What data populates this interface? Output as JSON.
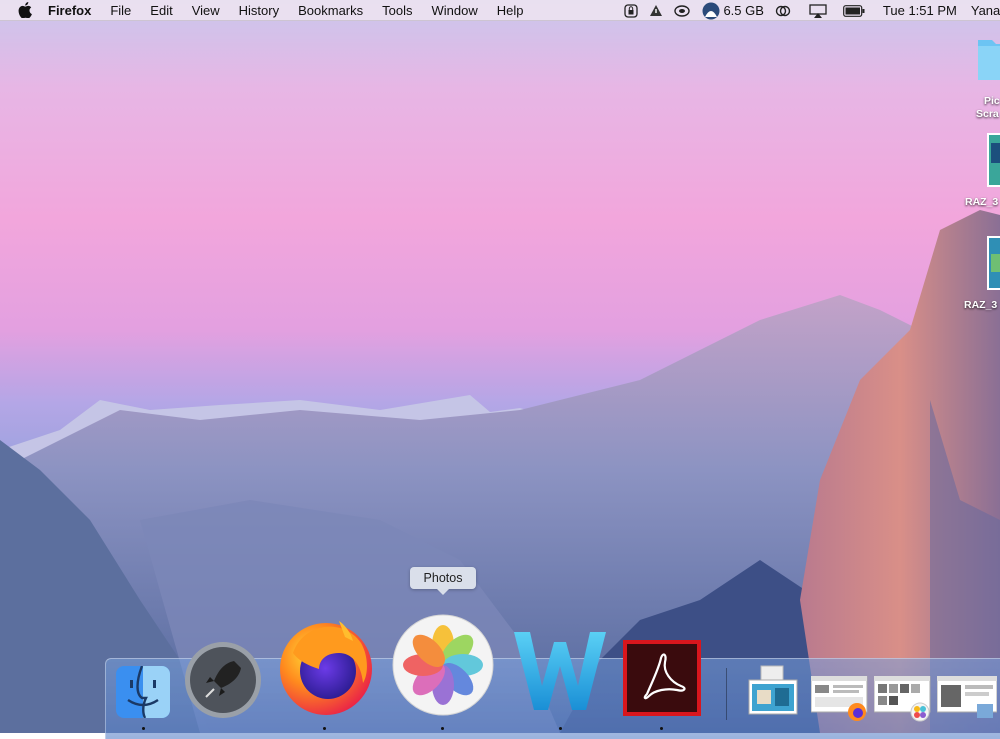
{
  "menubar": {
    "app_name": "Firefox",
    "menus": [
      "File",
      "Edit",
      "View",
      "History",
      "Bookmarks",
      "Tools",
      "Window",
      "Help"
    ],
    "storage": "6.5 GB",
    "clock": "Tue 1:51 PM",
    "user": "Yana G"
  },
  "desktop": {
    "items": [
      {
        "label_line1": "Pic",
        "label_line2": "Scra",
        "icon": "folder-icon"
      },
      {
        "label": "RAZ_3",
        "icon": "image-file-icon"
      },
      {
        "label": "RAZ_3",
        "icon": "image-file-icon"
      }
    ]
  },
  "dock": {
    "tooltip": "Photos",
    "apps": [
      {
        "name": "Finder",
        "icon": "finder-icon",
        "running": true
      },
      {
        "name": "Launchpad",
        "icon": "launchpad-icon",
        "running": false
      },
      {
        "name": "Firefox",
        "icon": "firefox-icon",
        "running": true
      },
      {
        "name": "Photos",
        "icon": "photos-icon",
        "running": true
      },
      {
        "name": "Microsoft Word",
        "icon": "word-icon",
        "running": true
      },
      {
        "name": "Adobe Acrobat",
        "icon": "acrobat-icon",
        "running": true
      }
    ],
    "minimized": [
      "minimized-window-1",
      "minimized-window-2",
      "minimized-window-3",
      "minimized-window-4"
    ]
  },
  "colors": {
    "menubar_bg": "#ece2f0",
    "acrobat_red": "#d9161d",
    "finder_blue": "#3a8ff0"
  }
}
